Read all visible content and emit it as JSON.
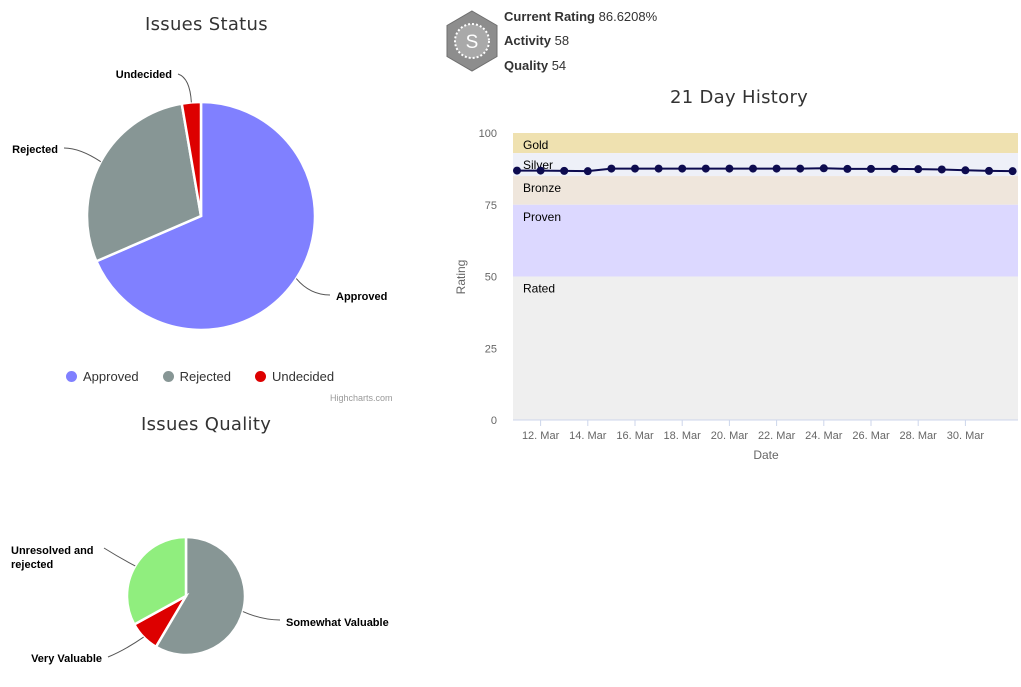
{
  "issues_status": {
    "title": "Issues Status",
    "legend": [
      {
        "label": "Approved",
        "color": "#8080ff"
      },
      {
        "label": "Rejected",
        "color": "#879695"
      },
      {
        "label": "Undecided",
        "color": "#dd0000"
      }
    ],
    "credits": "Highcharts.com"
  },
  "issues_quality": {
    "title": "Issues Quality"
  },
  "rating": {
    "current_label": "Current Rating",
    "current_value": "86.6208%",
    "activity_label": "Activity",
    "activity_value": "58",
    "quality_label": "Quality",
    "quality_value": "54",
    "badge_letter": "S"
  },
  "history": {
    "title": "21 Day History"
  },
  "chart_data": [
    {
      "type": "pie",
      "title": "Issues Status",
      "slices": [
        {
          "label": "Approved",
          "value": 68.5,
          "color": "#8080ff"
        },
        {
          "label": "Rejected",
          "value": 28.8,
          "color": "#879695"
        },
        {
          "label": "Undecided",
          "value": 2.7,
          "color": "#dd0000"
        }
      ],
      "legend": "bottom-center"
    },
    {
      "type": "pie",
      "title": "Issues Quality",
      "slices": [
        {
          "label": "Somewhat Valuable",
          "value": 58.5,
          "color": "#879695"
        },
        {
          "label": "Very Valuable",
          "value": 8.5,
          "color": "#dd0000"
        },
        {
          "label": "Unresolved and rejected",
          "value": 33.0,
          "color": "#90ee7e"
        }
      ]
    },
    {
      "type": "line",
      "title": "21 Day History",
      "xlabel": "Date",
      "ylabel": "Rating",
      "ylim": [
        0,
        100
      ],
      "yticks": [
        0,
        25,
        50,
        75,
        100
      ],
      "x_tick_labels": [
        "12. Mar",
        "14. Mar",
        "16. Mar",
        "18. Mar",
        "20. Mar",
        "22. Mar",
        "24. Mar",
        "26. Mar",
        "28. Mar",
        "30. Mar"
      ],
      "x": [
        "11. Mar",
        "12. Mar",
        "13. Mar",
        "14. Mar",
        "15. Mar",
        "16. Mar",
        "17. Mar",
        "18. Mar",
        "19. Mar",
        "20. Mar",
        "21. Mar",
        "22. Mar",
        "23. Mar",
        "24. Mar",
        "25. Mar",
        "26. Mar",
        "27. Mar",
        "28. Mar",
        "29. Mar",
        "30. Mar",
        "31. Mar",
        "1. Apr"
      ],
      "series": [
        {
          "values": [
            86.9,
            86.9,
            86.8,
            86.7,
            87.6,
            87.6,
            87.6,
            87.6,
            87.6,
            87.6,
            87.6,
            87.6,
            87.6,
            87.7,
            87.5,
            87.5,
            87.5,
            87.4,
            87.3,
            87.0,
            86.8,
            86.7
          ],
          "color": "#0d0b4f"
        }
      ],
      "bands": [
        {
          "label": "Gold",
          "from": 93,
          "to": 100,
          "color": "#efe1b0"
        },
        {
          "label": "Silver",
          "from": 85,
          "to": 93,
          "color": "#eef0f8"
        },
        {
          "label": "Bronze",
          "from": 75,
          "to": 85,
          "color": "#efe6dc"
        },
        {
          "label": "Proven",
          "from": 50,
          "to": 75,
          "color": "#dcd8ff"
        },
        {
          "label": "Rated",
          "from": 0,
          "to": 50,
          "color": "#efefef"
        }
      ],
      "grid": false
    }
  ]
}
